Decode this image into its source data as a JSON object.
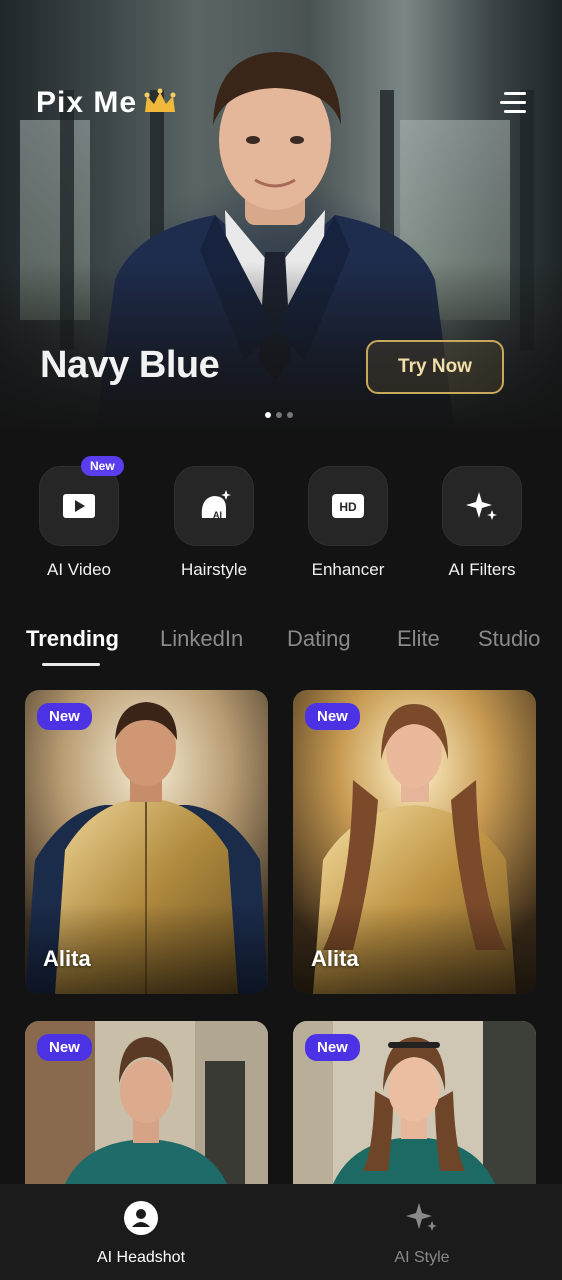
{
  "app": {
    "brand": "Pix Me",
    "crown_icon": "crown-icon"
  },
  "hero": {
    "title": "Navy Blue",
    "cta_label": "Try Now",
    "pagination": {
      "current": 1,
      "total": 3
    }
  },
  "features": [
    {
      "label": "AI Video",
      "icon": "play-icon",
      "badge": "New"
    },
    {
      "label": "Hairstyle",
      "icon": "ai-hairstyle-icon"
    },
    {
      "label": "Enhancer",
      "icon": "hd-icon"
    },
    {
      "label": "AI Filters",
      "icon": "sparkle-icon"
    }
  ],
  "tabs": [
    {
      "label": "Trending",
      "active": true
    },
    {
      "label": "LinkedIn"
    },
    {
      "label": "Dating"
    },
    {
      "label": "Elite"
    },
    {
      "label": "Studio"
    }
  ],
  "cards": [
    {
      "badge": "New",
      "name": "Alita"
    },
    {
      "badge": "New",
      "name": "Alita"
    },
    {
      "badge": "New",
      "name": ""
    },
    {
      "badge": "New",
      "name": ""
    }
  ],
  "bottom_nav": [
    {
      "label": "AI Headshot",
      "icon": "user-icon",
      "active": true
    },
    {
      "label": "AI Style",
      "icon": "sparkle-icon",
      "active": false
    }
  ],
  "colors": {
    "accent": "#4b32e5",
    "gold": "#c8a85a",
    "background": "#131313"
  }
}
